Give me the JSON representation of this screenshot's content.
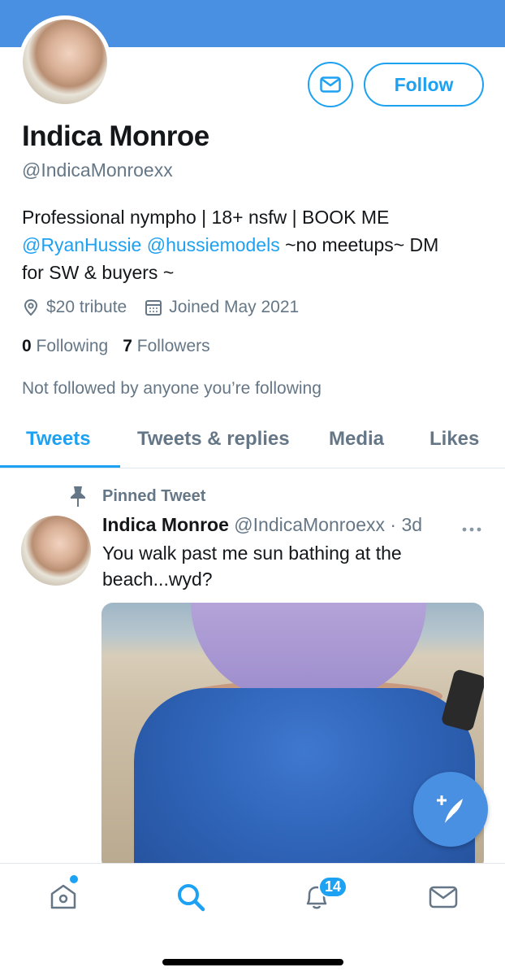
{
  "colors": {
    "accent": "#1da1f2",
    "banner": "#4a90e2",
    "secondary_text": "#657786"
  },
  "profile": {
    "name": "Indica Monroe",
    "handle": "@IndicaMonroexx",
    "bio_line1": "Professional nympho | 18+ nsfw | BOOK ME",
    "bio_mention1": "@RyanHussie",
    "bio_mention2": "@hussiemodels",
    "bio_line2_tail": " ~no meetups~ DM",
    "bio_line3": "for SW & buyers ~",
    "location": "$20 tribute",
    "joined": "Joined May 2021",
    "following_count": "0",
    "following_label": "Following",
    "followers_count": "7",
    "followers_label": "Followers",
    "not_followed": "Not followed by anyone you’re following"
  },
  "actions": {
    "follow_label": "Follow",
    "message_icon": "mail-icon"
  },
  "tabs": [
    {
      "label": "Tweets",
      "active": true
    },
    {
      "label": "Tweets & replies",
      "active": false
    },
    {
      "label": "Media",
      "active": false
    },
    {
      "label": "Likes",
      "active": false
    }
  ],
  "pinned_tweet": {
    "pinned_label": "Pinned Tweet",
    "author_name": "Indica Monroe",
    "author_handle": "@IndicaMonroexx",
    "separator": " · ",
    "time": "3d",
    "text": "You walk past me sun bathing at the beach...wyd?"
  },
  "bottom_nav": {
    "items": [
      "home-icon",
      "search-icon",
      "notifications-icon",
      "messages-icon"
    ],
    "notifications_badge": "14"
  }
}
